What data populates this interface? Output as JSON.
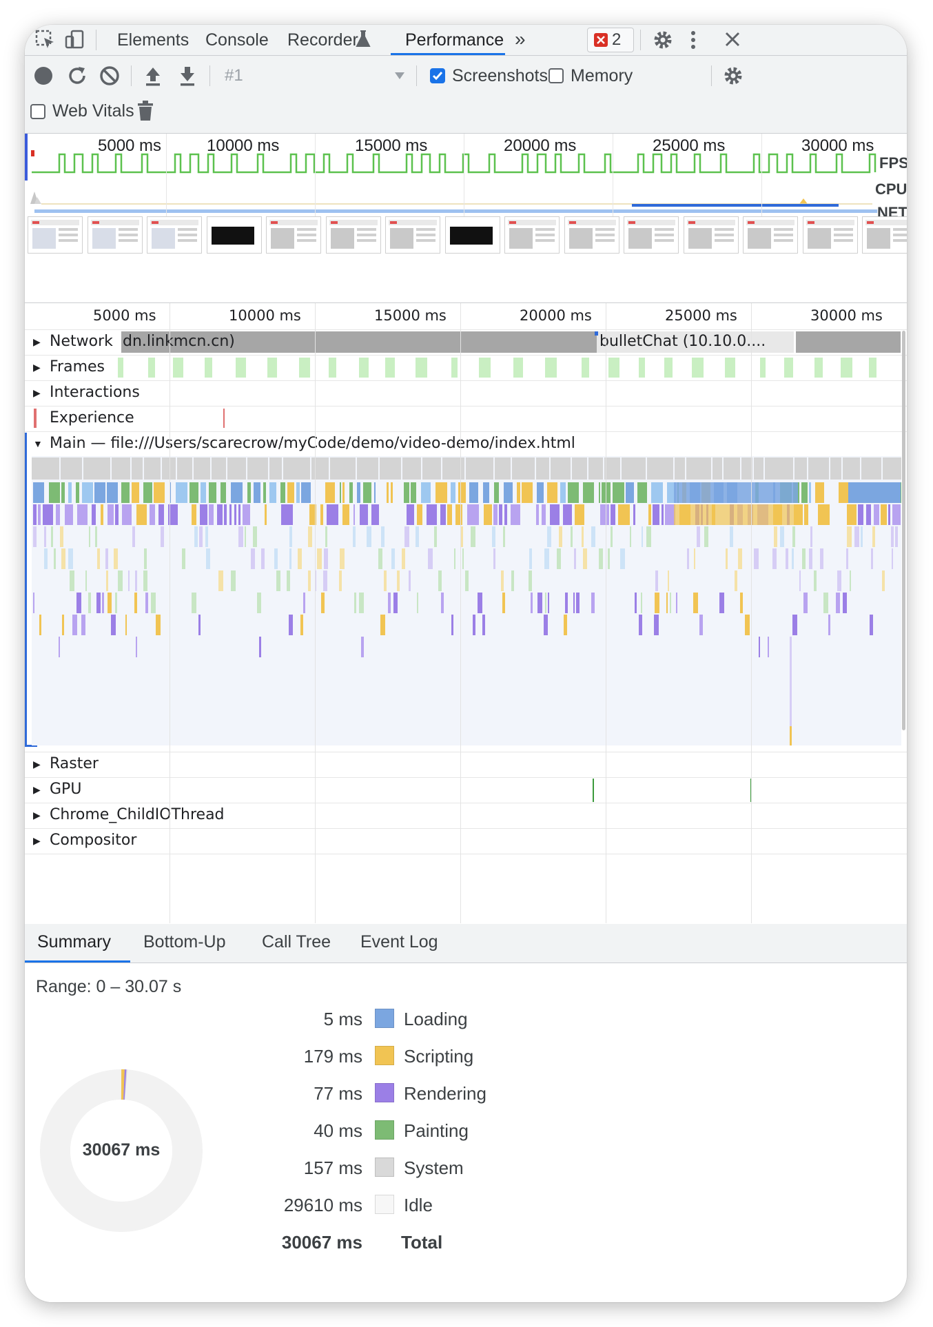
{
  "tabs": {
    "elements": "Elements",
    "console": "Console",
    "recorder": "Recorder",
    "performance": "Performance",
    "more": "»",
    "errors_count": "2"
  },
  "toolbar": {
    "profile_select": "#1",
    "screenshots_label": "Screenshots",
    "screenshots_checked": true,
    "memory_label": "Memory",
    "memory_checked": false,
    "webvitals_label": "Web Vitals",
    "webvitals_checked": false
  },
  "overview": {
    "ticks": [
      "5000 ms",
      "10000 ms",
      "15000 ms",
      "20000 ms",
      "25000 ms",
      "30000 ms"
    ],
    "fps_label": "FPS",
    "cpu_label": "CPU",
    "net_label": "NET"
  },
  "timeline": {
    "ticks": [
      "5000 ms",
      "10000 ms",
      "15000 ms",
      "20000 ms",
      "25000 ms",
      "30000 ms"
    ]
  },
  "tracks": {
    "network": "Network",
    "network_req1": "dn.linkmcn.cn)",
    "network_req2": "bulletChat (10.10.0....",
    "frames": "Frames",
    "interactions": "Interactions",
    "experience": "Experience",
    "main": "Main — file:///Users/scarecrow/myCode/demo/video-demo/index.html",
    "raster": "Raster",
    "gpu": "GPU",
    "childio": "Chrome_ChildIOThread",
    "compositor": "Compositor"
  },
  "bottom_tabs": {
    "summary": "Summary",
    "bottomup": "Bottom-Up",
    "calltree": "Call Tree",
    "eventlog": "Event Log"
  },
  "summary": {
    "range": "Range: 0 – 30.07 s",
    "total_center": "30067 ms",
    "rows": [
      {
        "value": "5 ms",
        "label": "Loading",
        "color": "#7ba6e0"
      },
      {
        "value": "179 ms",
        "label": "Scripting",
        "color": "#f1c453"
      },
      {
        "value": "77 ms",
        "label": "Rendering",
        "color": "#9b7fe6"
      },
      {
        "value": "40 ms",
        "label": "Painting",
        "color": "#7dbb74"
      },
      {
        "value": "157 ms",
        "label": "System",
        "color": "#d9d9d9"
      },
      {
        "value": "29610 ms",
        "label": "Idle",
        "color": "#f7f7f7"
      }
    ],
    "total_value": "30067 ms",
    "total_label": "Total"
  },
  "colors": {
    "accent": "#1a73e8",
    "frame_green": "#5cc14e",
    "loading": "#7ba6e0",
    "scripting": "#f1c453",
    "rendering": "#9b7fe6",
    "painting": "#7dbb74",
    "system": "#d9d9d9",
    "idle": "#f7f7f7"
  },
  "icons": [
    "inspect-icon",
    "device-toggle-icon",
    "recorder-flask-icon",
    "error-badge-icon",
    "gear-icon",
    "kebab-icon",
    "close-icon",
    "record-icon",
    "reload-icon",
    "clear-icon",
    "upload-icon",
    "download-icon",
    "trash-icon",
    "capture-settings-icon"
  ]
}
